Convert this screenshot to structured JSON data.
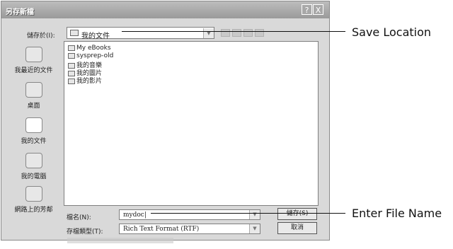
{
  "dialog": {
    "title": "另存新檔"
  },
  "title_buttons": {
    "help": "?",
    "close": "X"
  },
  "save_in": {
    "label": "儲存於(I):",
    "value": "我的文件"
  },
  "places": [
    {
      "label": "我最近的文件",
      "icon": "recent-documents-icon"
    },
    {
      "label": "桌面",
      "icon": "desktop-icon"
    },
    {
      "label": "我的文件",
      "icon": "my-documents-icon",
      "selected": true
    },
    {
      "label": "我的電腦",
      "icon": "my-computer-icon"
    },
    {
      "label": "網路上的芳鄰",
      "icon": "network-places-icon"
    }
  ],
  "files": [
    {
      "name": "My eBooks",
      "icon": "folder-icon"
    },
    {
      "name": "sysprep-old",
      "icon": "folder-icon"
    },
    {
      "name": "我的音樂",
      "icon": "music-folder-icon"
    },
    {
      "name": "我的圖片",
      "icon": "pictures-folder-icon"
    },
    {
      "name": "我的影片",
      "icon": "videos-folder-icon"
    }
  ],
  "file_name": {
    "label": "檔名(N):",
    "value": "mydoc|"
  },
  "file_type": {
    "label": "存檔類型(T):",
    "value": "Rich Text Format (RTF)"
  },
  "buttons": {
    "save": "儲存(S)",
    "cancel": "取消"
  },
  "callouts": {
    "save_location": "Save Location",
    "enter_file_name": "Enter File Name"
  }
}
